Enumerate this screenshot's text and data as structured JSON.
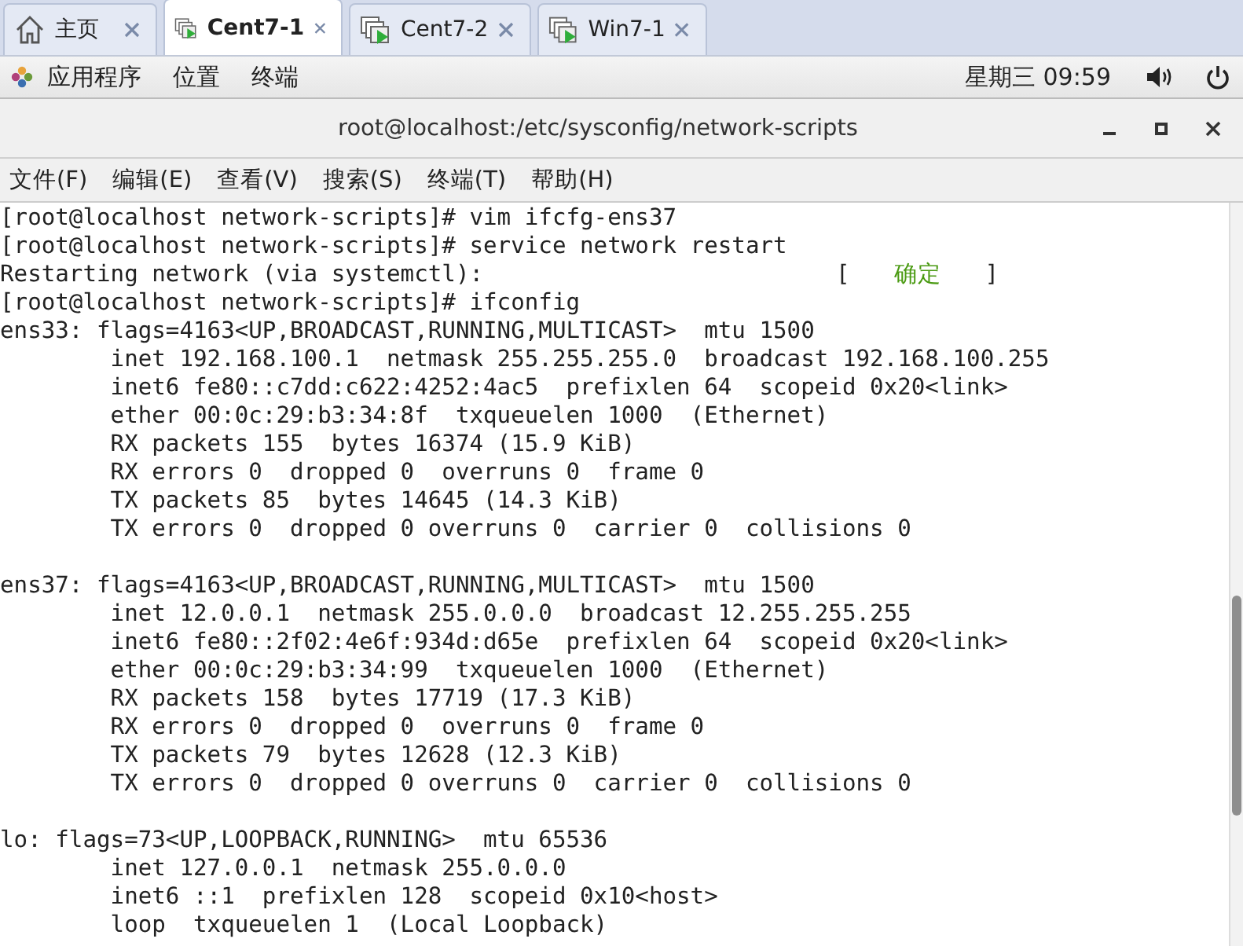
{
  "tabs": [
    {
      "kind": "home",
      "label": "主页",
      "selected": false
    },
    {
      "kind": "vm",
      "label": "Cent7-1",
      "selected": true
    },
    {
      "kind": "vm",
      "label": "Cent7-2",
      "selected": false
    },
    {
      "kind": "vm",
      "label": "Win7-1",
      "selected": false
    }
  ],
  "top_panel": {
    "menus": [
      "应用程序",
      "位置",
      "终端"
    ],
    "clock": "星期三 09:59"
  },
  "window": {
    "title": "root@localhost:/etc/sysconfig/network-scripts"
  },
  "menu_bar": [
    "文件(F)",
    "编辑(E)",
    "查看(V)",
    "搜索(S)",
    "终端(T)",
    "帮助(H)"
  ],
  "terminal": {
    "lines": [
      {
        "kind": "plain",
        "text": "[root@localhost network-scripts]# vim ifcfg-ens37"
      },
      {
        "kind": "plain",
        "text": "[root@localhost network-scripts]# service network restart"
      },
      {
        "kind": "status",
        "text": "Restarting network (via systemctl):",
        "status_left": "[",
        "status": "确定",
        "status_right": "]"
      },
      {
        "kind": "plain",
        "text": "[root@localhost network-scripts]# ifconfig"
      },
      {
        "kind": "plain",
        "text": "ens33: flags=4163<UP,BROADCAST,RUNNING,MULTICAST>  mtu 1500"
      },
      {
        "kind": "plain",
        "text": "        inet 192.168.100.1  netmask 255.255.255.0  broadcast 192.168.100.255"
      },
      {
        "kind": "plain",
        "text": "        inet6 fe80::c7dd:c622:4252:4ac5  prefixlen 64  scopeid 0x20<link>"
      },
      {
        "kind": "plain",
        "text": "        ether 00:0c:29:b3:34:8f  txqueuelen 1000  (Ethernet)"
      },
      {
        "kind": "plain",
        "text": "        RX packets 155  bytes 16374 (15.9 KiB)"
      },
      {
        "kind": "plain",
        "text": "        RX errors 0  dropped 0  overruns 0  frame 0"
      },
      {
        "kind": "plain",
        "text": "        TX packets 85  bytes 14645 (14.3 KiB)"
      },
      {
        "kind": "plain",
        "text": "        TX errors 0  dropped 0 overruns 0  carrier 0  collisions 0"
      },
      {
        "kind": "blank"
      },
      {
        "kind": "plain",
        "text": "ens37: flags=4163<UP,BROADCAST,RUNNING,MULTICAST>  mtu 1500"
      },
      {
        "kind": "plain",
        "text": "        inet 12.0.0.1  netmask 255.0.0.0  broadcast 12.255.255.255"
      },
      {
        "kind": "plain",
        "text": "        inet6 fe80::2f02:4e6f:934d:d65e  prefixlen 64  scopeid 0x20<link>"
      },
      {
        "kind": "plain",
        "text": "        ether 00:0c:29:b3:34:99  txqueuelen 1000  (Ethernet)"
      },
      {
        "kind": "plain",
        "text": "        RX packets 158  bytes 17719 (17.3 KiB)"
      },
      {
        "kind": "plain",
        "text": "        RX errors 0  dropped 0  overruns 0  frame 0"
      },
      {
        "kind": "plain",
        "text": "        TX packets 79  bytes 12628 (12.3 KiB)"
      },
      {
        "kind": "plain",
        "text": "        TX errors 0  dropped 0 overruns 0  carrier 0  collisions 0"
      },
      {
        "kind": "blank"
      },
      {
        "kind": "plain",
        "text": "lo: flags=73<UP,LOOPBACK,RUNNING>  mtu 65536"
      },
      {
        "kind": "plain",
        "text": "        inet 127.0.0.1  netmask 255.0.0.0"
      },
      {
        "kind": "plain",
        "text": "        inet6 ::1  prefixlen 128  scopeid 0x10<host>"
      },
      {
        "kind": "plain",
        "text": "        loop  txqueuelen 1  (Local Loopback)"
      }
    ]
  }
}
